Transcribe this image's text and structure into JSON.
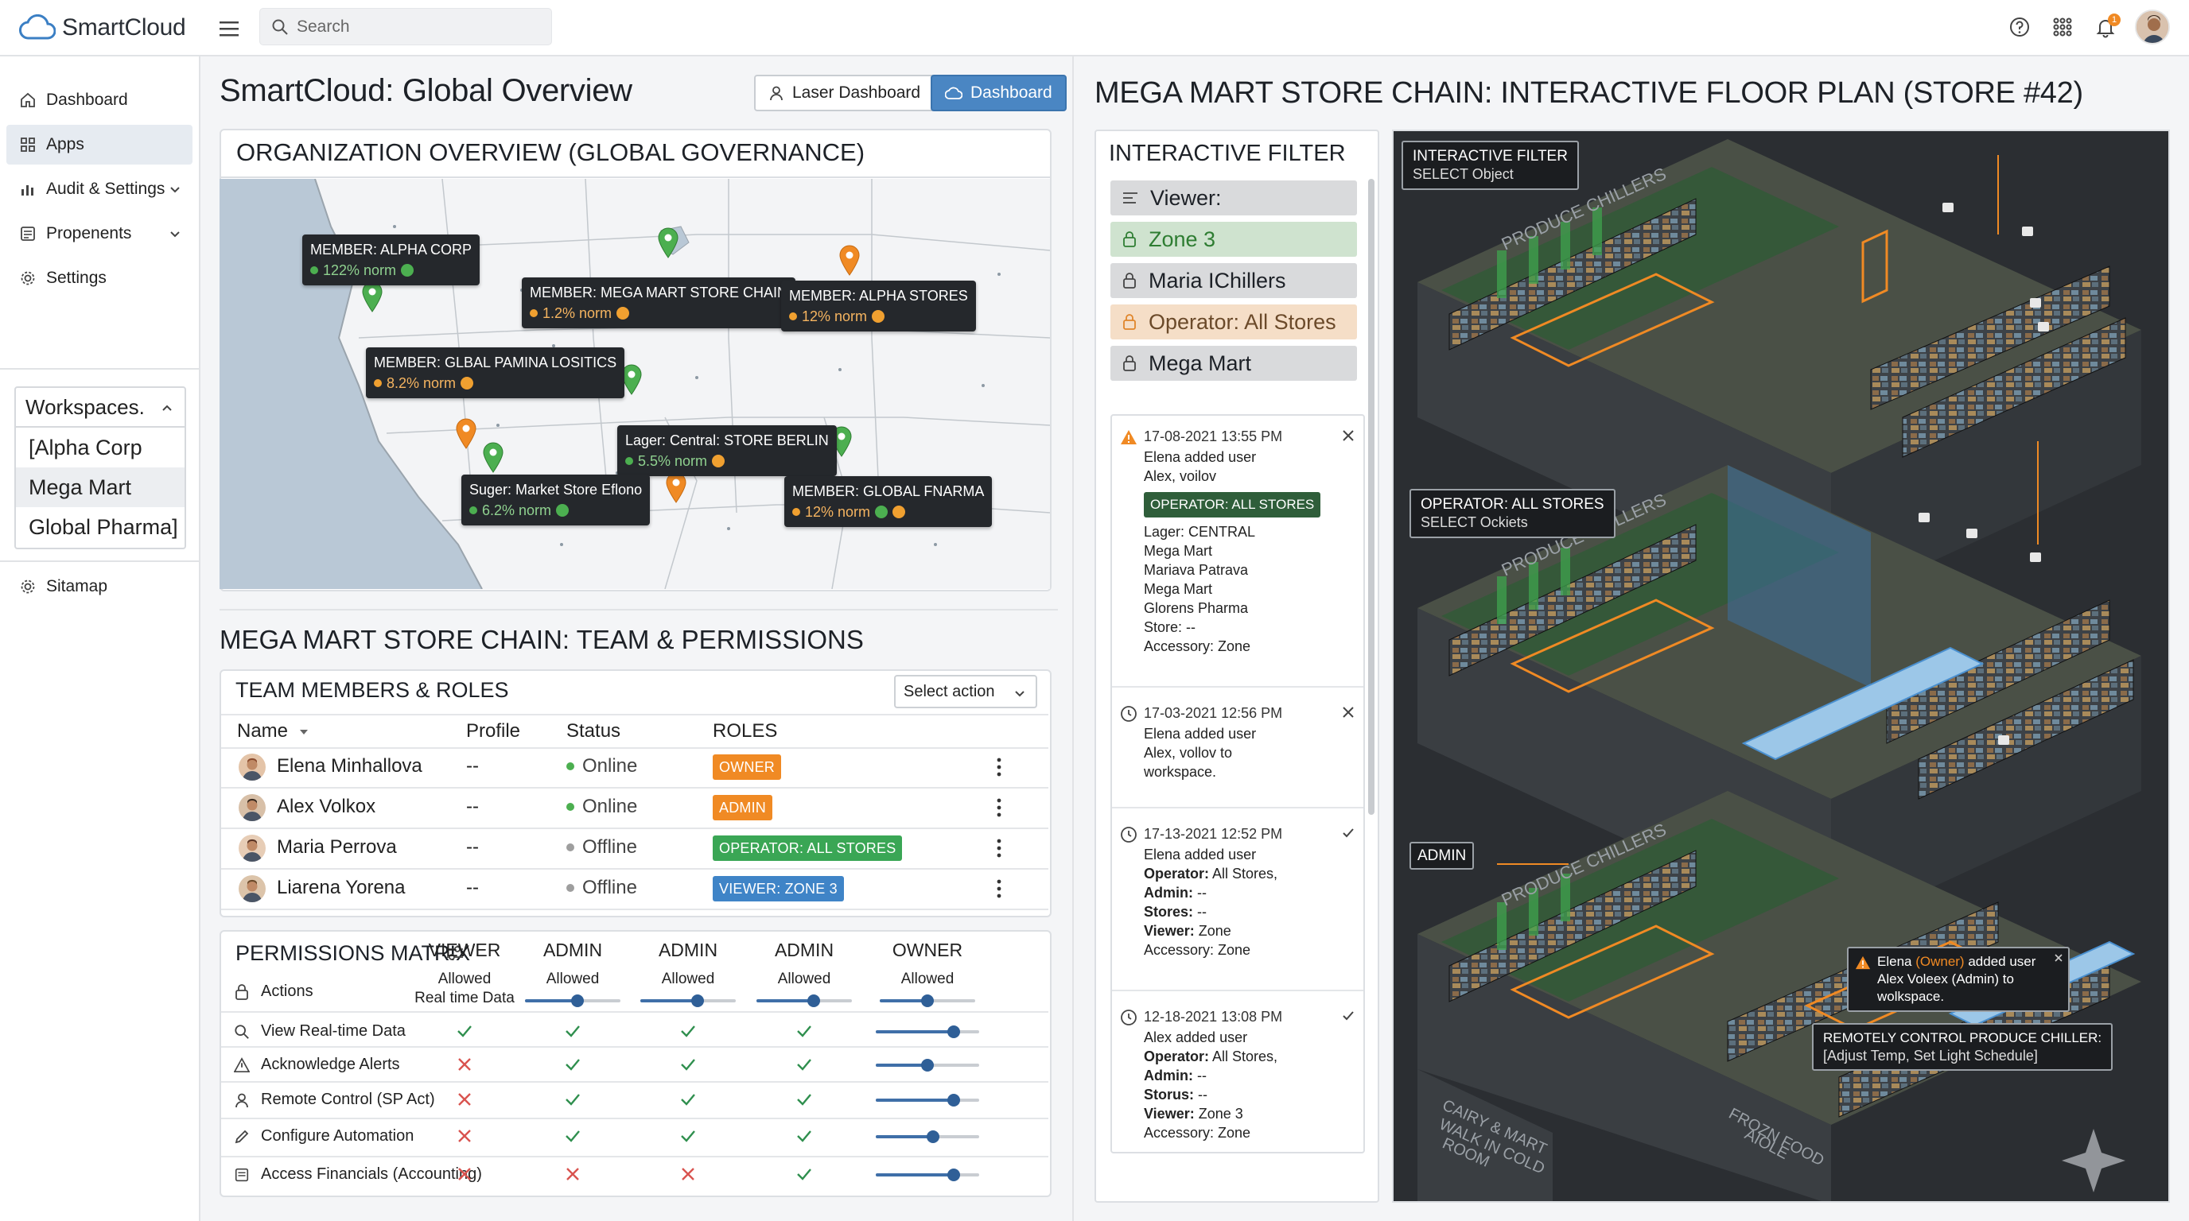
{
  "app": {
    "name": "SmartCloud"
  },
  "search": {
    "placeholder": "Search"
  },
  "topbar": {
    "notification_count": "1"
  },
  "sidebar": {
    "items": [
      {
        "label": "Dashboard"
      },
      {
        "label": "Apps"
      },
      {
        "label": "Audit & Settings"
      },
      {
        "label": "Propenents"
      },
      {
        "label": "Settings"
      }
    ],
    "workspaces": {
      "title": "Workspaces.",
      "items": [
        "[Alpha Corp",
        "Mega Mart",
        "Global Pharma]"
      ]
    },
    "sitemap": "Sitamap"
  },
  "overview": {
    "title": "SmartCloud: Global Overview",
    "laser_button": "Laser Dashboard",
    "dashboard_button": "Dashboard",
    "org_title": "ORGANIZATION OVERVIEW (GLOBAL GOVERNANCE)",
    "map_tips": [
      {
        "label": "MEMBER: ALPHA CORP",
        "norm": "122% norm",
        "color": "#4caf50"
      },
      {
        "label": "MEMBER: MEGA MART STORE CHAIN",
        "norm": "1.2% norm",
        "color": "#f0a030"
      },
      {
        "label": "MEMBER: ALPHA STORES",
        "norm": "12% norm",
        "color": "#f0a030"
      },
      {
        "label": "MEMBER: GLBAL PAMINA LOSITICS",
        "norm": "8.2% norm",
        "color": "#f0a030"
      },
      {
        "label": "Lager: Central:  STORE BERLIN",
        "norm": "5.5% norm",
        "color": "#f0a030"
      },
      {
        "label": "Suger: Market Store Eflono",
        "norm": "6.2% norm",
        "color": "#4caf50"
      },
      {
        "label": "MEMBER: GLOBAL FNARMA",
        "norm": "12% norm",
        "color": "#f0a030"
      }
    ]
  },
  "team": {
    "section_title": "MEGA MART STORE CHAIN: TEAM & PERMISSIONS",
    "card_title": "TEAM MEMBERS & ROLES",
    "select_action": "Select action",
    "columns": [
      "Name",
      "Profile",
      "Status",
      "ROLES"
    ],
    "members": [
      {
        "name": "Elena Minhallova",
        "profile": "--",
        "status": "Online",
        "status_color": "#4caf50",
        "role": "OWNER",
        "role_color": "#f08a24"
      },
      {
        "name": "Alex Volkox",
        "profile": "--",
        "status": "Online",
        "status_color": "#4caf50",
        "role": "ADMIN",
        "role_color": "#f08a24"
      },
      {
        "name": "Maria Perrova",
        "profile": "--",
        "status": "Offline",
        "status_color": "#9e9e9e",
        "role": "OPERATOR: ALL STORES",
        "role_color": "#3aa655"
      },
      {
        "name": "Liarena Yorena",
        "profile": "--",
        "status": "Offline",
        "status_color": "#9e9e9e",
        "role": "VIEWER: ZONE 3",
        "role_color": "#3f84c7"
      }
    ]
  },
  "permissions": {
    "title": "PERMISSIONS MATRIX",
    "columns": [
      {
        "name": "VIEWER",
        "sub": "Allowed\nReal time Data"
      },
      {
        "name": "ADMIN",
        "sub": "Allowed"
      },
      {
        "name": "ADMIN",
        "sub": "Allowed"
      },
      {
        "name": "ADMIN",
        "sub": "Allowed"
      },
      {
        "name": "OWNER",
        "sub": "Allowed"
      }
    ],
    "header_row": "Actions",
    "rows": [
      {
        "label": "View Real-time Data",
        "cells": [
          "check",
          "check",
          "check",
          "check"
        ],
        "level": 0.75
      },
      {
        "label": "Acknowledge Alerts",
        "cells": [
          "cross",
          "check",
          "check",
          "check"
        ],
        "level": 0.5
      },
      {
        "label": "Remote Control (SP Act)",
        "cells": [
          "cross",
          "check",
          "check",
          "check"
        ],
        "level": 0.75
      },
      {
        "label": "Configure Automation",
        "cells": [
          "cross",
          "check",
          "check",
          "check"
        ],
        "level": 0.55
      },
      {
        "label": "Access Financials (Accounting)",
        "cells": [
          "cross",
          "cross",
          "cross",
          "check"
        ],
        "level": 0.75
      }
    ],
    "header_levels": [
      0.55,
      0.6,
      0.6,
      0.5
    ]
  },
  "floorplan": {
    "title": "MEGA MART STORE CHAIN: INTERACTIVE FLOOR PLAN (STORE #42)",
    "filter": {
      "title": "INTERACTIVE FILTER",
      "items": [
        {
          "label": "Viewer:",
          "style": "gray",
          "icon": "list"
        },
        {
          "label": "Zone 3",
          "style": "green",
          "icon": "lock"
        },
        {
          "label": "Maria IChillers",
          "style": "gray",
          "icon": "lock"
        },
        {
          "label": "Operator: All Stores",
          "style": "orange",
          "icon": "lock"
        },
        {
          "label": "Mega Mart",
          "style": "gray",
          "icon": "lock"
        }
      ]
    },
    "log": [
      {
        "time": "17-08-2021 13:55 PM",
        "lines": [
          "Elena added user",
          "Alex, voilov"
        ],
        "badge": "OPERATOR: ALL STORES",
        "extra": [
          "Lager: CENTRAL",
          "Mega Mart",
          "Mariava Patrava",
          "Mega Mart",
          "Glorens Pharma",
          "Store: --",
          "Accessory: Zone"
        ]
      },
      {
        "time": "17-03-2021 12:56 PM",
        "lines": [
          "Elena added user",
          "Alex, vollov to",
          "workspace."
        ]
      },
      {
        "time": "17-13-2021 12:52 PM",
        "lines": [
          "Elena added user"
        ],
        "kv": [
          [
            "Operator:",
            "All Stores,"
          ],
          [
            "Admin:",
            "--"
          ],
          [
            "Stores:",
            "--"
          ],
          [
            "Viewer:",
            "Zone"
          ]
        ],
        "tail": "Accessory: Zone"
      },
      {
        "time": "12-18-2021 13:08 PM",
        "lines": [
          "Alex added user"
        ],
        "kv": [
          [
            "Operator:",
            "All Stores,"
          ],
          [
            "Admin:",
            "--"
          ],
          [
            "Storus:",
            "--"
          ],
          [
            "Viewer:",
            "Zone 3"
          ]
        ],
        "tail": "Accessory: Zone"
      }
    ],
    "overlays": {
      "filter_tip_title": "INTERACTIVE FILTER",
      "filter_tip_sub": "SELECT Object",
      "operator_tip_title": "OPERATOR: ALL STORES",
      "operator_tip_sub": "SELECT Ockiets",
      "admin_tag": "ADMIN",
      "alert_text_1": "Elena ",
      "alert_owner": "(Owner)",
      "alert_text_2": " added user",
      "alert_text_3": "Alex Voleex (Admin) to",
      "alert_text_4": "wolkspace.",
      "remote_title": "REMOTELY CONTROL PRODUCE CHILLER:",
      "remote_sub": "[Adjust Temp, Set Light Schedule]",
      "zone_labels": [
        "PRODUCE CHILLERS",
        "PRODUCE CHILLERS",
        "PRODUCE CHILLERS"
      ],
      "dairy_label": "CAIRY & MART\nWALK IN COLD\nROOM",
      "frozen_label": "FROZN FOOD\nAIOLE"
    }
  }
}
